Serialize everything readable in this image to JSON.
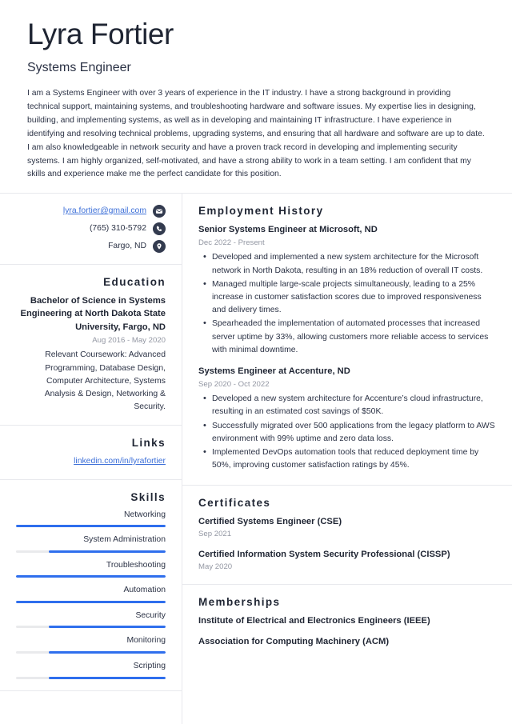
{
  "header": {
    "name": "Lyra Fortier",
    "title": "Systems Engineer",
    "summary": "I am a Systems Engineer with over 3 years of experience in the IT industry. I have a strong background in providing technical support, maintaining systems, and troubleshooting hardware and software issues. My expertise lies in designing, building, and implementing systems, as well as in developing and maintaining IT infrastructure. I have experience in identifying and resolving technical problems, upgrading systems, and ensuring that all hardware and software are up to date. I am also knowledgeable in network security and have a proven track record in developing and implementing security systems. I am highly organized, self-motivated, and have a strong ability to work in a team setting. I am confident that my skills and experience make me the perfect candidate for this position."
  },
  "contacts": [
    {
      "text": "lyra.fortier@gmail.com",
      "icon": "envelope-icon",
      "is_link": true
    },
    {
      "text": "(765) 310-5792",
      "icon": "phone-icon",
      "is_link": false
    },
    {
      "text": "Fargo, ND",
      "icon": "location-pin-icon",
      "is_link": false
    }
  ],
  "education": {
    "section_title": "Education",
    "entries": [
      {
        "degree": "Bachelor of Science in Systems Engineering at North Dakota State University, Fargo, ND",
        "date": "Aug 2016 - May 2020",
        "description": "Relevant Coursework: Advanced Programming, Database Design, Computer Architecture, Systems Analysis & Design, Networking & Security."
      }
    ]
  },
  "links": {
    "section_title": "Links",
    "items": [
      {
        "text": "linkedin.com/in/lyrafortier"
      }
    ]
  },
  "skills": {
    "section_title": "Skills",
    "items": [
      {
        "name": "Networking",
        "level": 100
      },
      {
        "name": "System Administration",
        "level": 78
      },
      {
        "name": "Troubleshooting",
        "level": 100
      },
      {
        "name": "Automation",
        "level": 100
      },
      {
        "name": "Security",
        "level": 78
      },
      {
        "name": "Monitoring",
        "level": 78
      },
      {
        "name": "Scripting",
        "level": 78
      }
    ]
  },
  "employment": {
    "section_title": "Employment History",
    "entries": [
      {
        "title": "Senior Systems Engineer at Microsoft, ND",
        "date": "Dec 2022 - Present",
        "bullets": [
          "Developed and implemented a new system architecture for the Microsoft network in North Dakota, resulting in an 18% reduction of overall IT costs.",
          "Managed multiple large-scale projects simultaneously, leading to a 25% increase in customer satisfaction scores due to improved responsiveness and delivery times.",
          "Spearheaded the implementation of automated processes that increased server uptime by 33%, allowing customers more reliable access to services with minimal downtime."
        ]
      },
      {
        "title": "Systems Engineer at Accenture, ND",
        "date": "Sep 2020 - Oct 2022",
        "bullets": [
          "Developed a new system architecture for Accenture’s cloud infrastructure, resulting in an estimated cost savings of $50K.",
          "Successfully migrated over 500 applications from the legacy platform to AWS environment with 99% uptime and zero data loss.",
          "Implemented DevOps automation tools that reduced deployment time by 50%, improving customer satisfaction ratings by 45%."
        ]
      }
    ]
  },
  "certificates": {
    "section_title": "Certificates",
    "entries": [
      {
        "title": "Certified Systems Engineer (CSE)",
        "date": "Sep 2021"
      },
      {
        "title": "Certified Information System Security Professional (CISSP)",
        "date": "May 2020"
      }
    ]
  },
  "memberships": {
    "section_title": "Memberships",
    "entries": [
      {
        "title": "Institute of Electrical and Electronics Engineers (IEEE)"
      },
      {
        "title": "Association for Computing Machinery (ACM)"
      }
    ]
  },
  "colors": {
    "accent": "#2f6fed",
    "link": "#3c6fd8",
    "icon_bg": "#333b4f",
    "heading": "#1f2533",
    "muted": "#9397a3",
    "divider": "#e8e9ed",
    "track": "#e9eaec"
  }
}
